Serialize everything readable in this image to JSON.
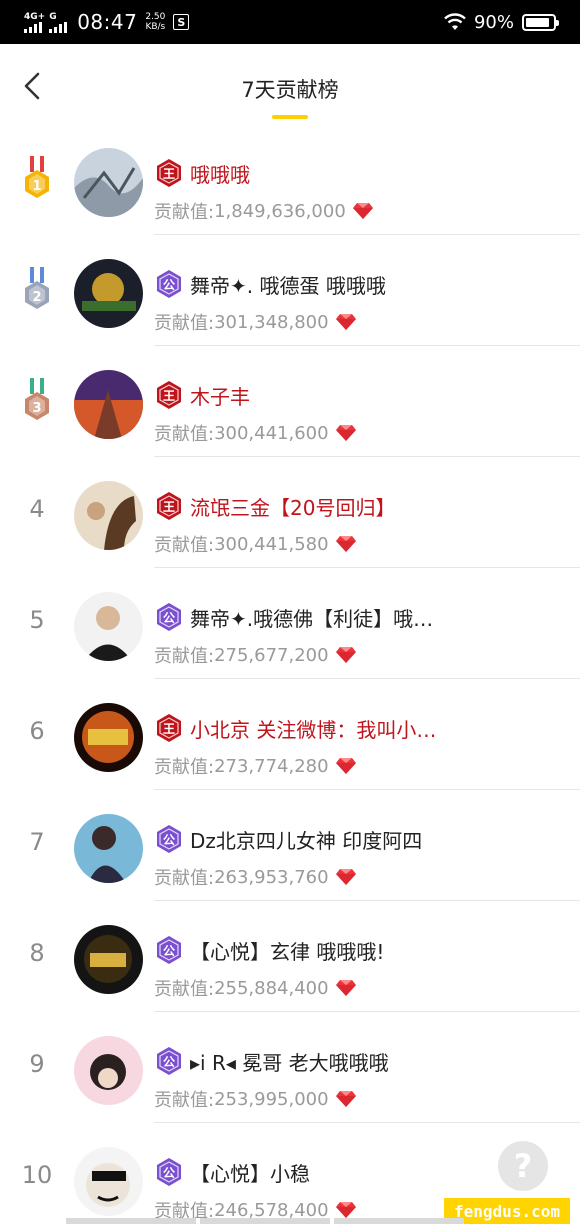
{
  "status_bar": {
    "network_1": "4G+",
    "network_2": "G",
    "time": "08:47",
    "speed_value": "2.50",
    "speed_unit": "KB/s",
    "sim_icon_label": "S",
    "battery_text": "90%",
    "battery_level": 0.9
  },
  "header": {
    "title": "7天贡献榜",
    "accent_color": "#fdd100"
  },
  "contribution_label": "贡献值:",
  "rows": [
    {
      "rank": "1",
      "badge": "王",
      "badge_type": "king",
      "name": "哦哦哦",
      "name_red": true,
      "value": "1,849,636,000"
    },
    {
      "rank": "2",
      "badge": "公",
      "badge_type": "duke",
      "name": "舞帝✦. 哦德蛋 哦哦哦",
      "name_red": false,
      "value": "301,348,800"
    },
    {
      "rank": "3",
      "badge": "王",
      "badge_type": "king",
      "name": "木子丰",
      "name_red": true,
      "value": "300,441,600"
    },
    {
      "rank": "4",
      "badge": "王",
      "badge_type": "king",
      "name": "流氓三金【20号回归】",
      "name_red": true,
      "value": "300,441,580"
    },
    {
      "rank": "5",
      "badge": "公",
      "badge_type": "duke",
      "name": "舞帝✦.哦德佛【利徒】哦…",
      "name_red": false,
      "value": "275,677,200"
    },
    {
      "rank": "6",
      "badge": "王",
      "badge_type": "king",
      "name": "小北京 关注微博：我叫小…",
      "name_red": true,
      "value": "273,774,280"
    },
    {
      "rank": "7",
      "badge": "公",
      "badge_type": "duke",
      "name": "Dz北京四儿女神 印度阿四",
      "name_red": false,
      "value": "263,953,760"
    },
    {
      "rank": "8",
      "badge": "公",
      "badge_type": "duke",
      "name": "【心悦】玄律 哦哦哦!",
      "name_red": false,
      "value": "255,884,400"
    },
    {
      "rank": "9",
      "badge": "公",
      "badge_type": "duke",
      "name": "▸i R◂ 冕哥  老大哦哦哦",
      "name_red": false,
      "value": "253,995,000"
    },
    {
      "rank": "10",
      "badge": "公",
      "badge_type": "duke",
      "name": "【心悦】小稳",
      "name_red": false,
      "value": "246,578,400"
    }
  ],
  "medal_colors": [
    "#f5b400",
    "#9aa4b8",
    "#c8876a"
  ],
  "help_button": "?",
  "watermark": "fengdus.com",
  "colors": {
    "king_badge": "#c0141c",
    "duke_badge": "#7a4fd0",
    "red_name": "#c0141c",
    "gem": "#e8343a"
  }
}
